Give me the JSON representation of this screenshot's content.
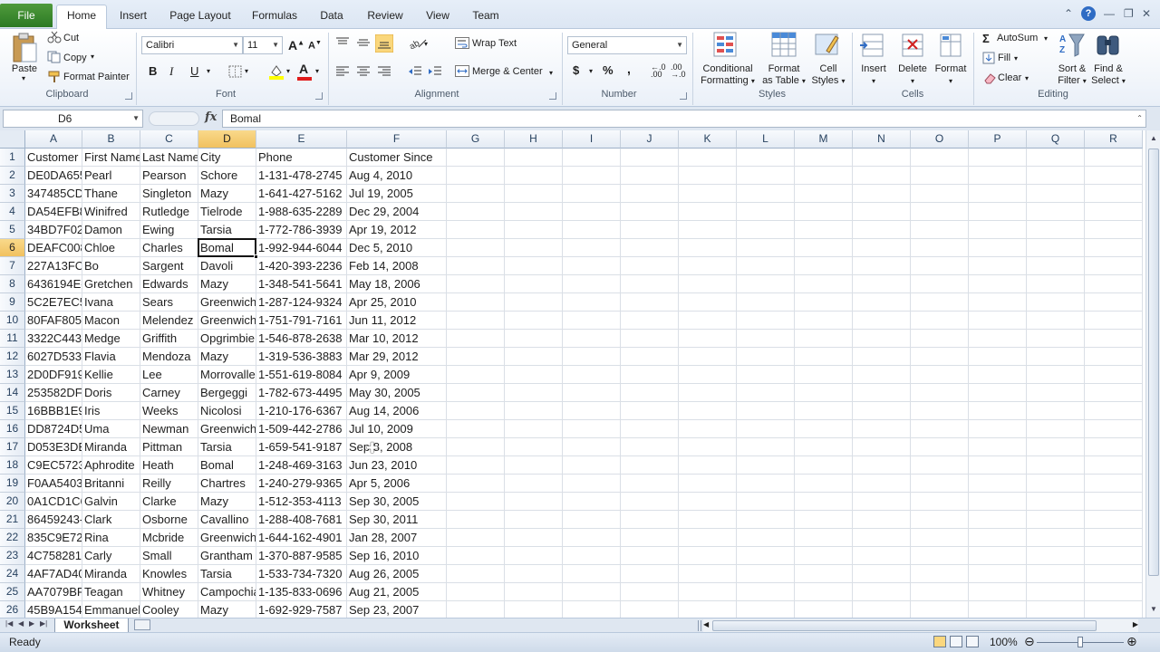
{
  "ribbon_tabs": {
    "file": "File",
    "home": "Home",
    "insert": "Insert",
    "page_layout": "Page Layout",
    "formulas": "Formulas",
    "data": "Data",
    "review": "Review",
    "view": "View",
    "team": "Team"
  },
  "clipboard": {
    "paste": "Paste",
    "cut": "Cut",
    "copy": "Copy",
    "format_painter": "Format Painter",
    "label": "Clipboard"
  },
  "font": {
    "name": "Calibri",
    "size": "11",
    "bold": "B",
    "italic": "I",
    "underline": "U",
    "label": "Font"
  },
  "alignment": {
    "wrap_text": "Wrap Text",
    "merge_center": "Merge & Center",
    "label": "Alignment"
  },
  "number": {
    "format": "General",
    "currency": "$",
    "percent": "%",
    "comma": ",",
    "label": "Number"
  },
  "styles": {
    "conditional": "Conditional",
    "conditional2": "Formatting",
    "format_as": "Format",
    "format_as2": "as Table",
    "cell": "Cell",
    "cell2": "Styles",
    "label": "Styles"
  },
  "cells": {
    "insert": "Insert",
    "delete": "Delete",
    "format": "Format",
    "label": "Cells"
  },
  "editing": {
    "autosum": "AutoSum",
    "fill": "Fill",
    "clear": "Clear",
    "sort": "Sort &",
    "sort2": "Filter",
    "find": "Find &",
    "find2": "Select",
    "label": "Editing",
    "sigma": "Σ"
  },
  "formula_bar": {
    "name_box": "D6",
    "fx": "fx",
    "content": "Bomal"
  },
  "columns": [
    "A",
    "B",
    "C",
    "D",
    "E",
    "F",
    "G",
    "H",
    "I",
    "J",
    "K",
    "L",
    "M",
    "N",
    "O",
    "P",
    "Q",
    "R"
  ],
  "rows": [
    {
      "n": "1",
      "cells": [
        "Customer",
        "First Name",
        "Last Name",
        "City",
        "Phone",
        "Customer Since"
      ]
    },
    {
      "n": "2",
      "cells": [
        "DE0DA655",
        "Pearl",
        "Pearson",
        "Schore",
        "1-131-478-2745",
        "Aug 4, 2010"
      ]
    },
    {
      "n": "3",
      "cells": [
        "347485CD-",
        "Thane",
        "Singleton",
        "Mazy",
        "1-641-427-5162",
        "Jul 19, 2005"
      ]
    },
    {
      "n": "4",
      "cells": [
        "DA54EFB8",
        "Winifred",
        "Rutledge",
        "Tielrode",
        "1-988-635-2289",
        "Dec 29, 2004"
      ]
    },
    {
      "n": "5",
      "cells": [
        "34BD7F02-",
        "Damon",
        "Ewing",
        "Tarsia",
        "1-772-786-3939",
        "Apr 19, 2012"
      ]
    },
    {
      "n": "6",
      "cells": [
        "DEAFC008",
        "Chloe",
        "Charles",
        "Bomal",
        "1-992-944-6044",
        "Dec 5, 2010"
      ]
    },
    {
      "n": "7",
      "cells": [
        "227A13FC-",
        "Bo",
        "Sargent",
        "Davoli",
        "1-420-393-2236",
        "Feb 14, 2008"
      ]
    },
    {
      "n": "8",
      "cells": [
        "6436194E-",
        "Gretchen",
        "Edwards",
        "Mazy",
        "1-348-541-5641",
        "May 18, 2006"
      ]
    },
    {
      "n": "9",
      "cells": [
        "5C2E7EC5-",
        "Ivana",
        "Sears",
        "Greenwich",
        "1-287-124-9324",
        "Apr 25, 2010"
      ]
    },
    {
      "n": "10",
      "cells": [
        "80FAF805-",
        "Macon",
        "Melendez",
        "Greenwich",
        "1-751-791-7161",
        "Jun 11, 2012"
      ]
    },
    {
      "n": "11",
      "cells": [
        "3322C443-",
        "Medge",
        "Griffith",
        "Opgrimbie",
        "1-546-878-2638",
        "Mar 10, 2012"
      ]
    },
    {
      "n": "12",
      "cells": [
        "6027D533-",
        "Flavia",
        "Mendoza",
        "Mazy",
        "1-319-536-3883",
        "Mar 29, 2012"
      ]
    },
    {
      "n": "13",
      "cells": [
        "2D0DF919",
        "Kellie",
        "Lee",
        "Morrovalle",
        "1-551-619-8084",
        "Apr 9, 2009"
      ]
    },
    {
      "n": "14",
      "cells": [
        "253582DF-",
        "Doris",
        "Carney",
        "Bergeggi",
        "1-782-673-4495",
        "May 30, 2005"
      ]
    },
    {
      "n": "15",
      "cells": [
        "16BBB1E9-",
        "Iris",
        "Weeks",
        "Nicolosi",
        "1-210-176-6367",
        "Aug 14, 2006"
      ]
    },
    {
      "n": "16",
      "cells": [
        "DD8724D5",
        "Uma",
        "Newman",
        "Greenwich",
        "1-509-442-2786",
        "Jul 10, 2009"
      ]
    },
    {
      "n": "17",
      "cells": [
        "D053E3DE",
        "Miranda",
        "Pittman",
        "Tarsia",
        "1-659-541-9187",
        "Sep 8, 2008"
      ]
    },
    {
      "n": "18",
      "cells": [
        "C9EC5723-",
        "Aphrodite",
        "Heath",
        "Bomal",
        "1-248-469-3163",
        "Jun 23, 2010"
      ]
    },
    {
      "n": "19",
      "cells": [
        "F0AA5403",
        "Britanni",
        "Reilly",
        "Chartres",
        "1-240-279-9365",
        "Apr 5, 2006"
      ]
    },
    {
      "n": "20",
      "cells": [
        "0A1CD1C6",
        "Galvin",
        "Clarke",
        "Mazy",
        "1-512-353-4113",
        "Sep 30, 2005"
      ]
    },
    {
      "n": "21",
      "cells": [
        "86459243-",
        "Clark",
        "Osborne",
        "Cavallino",
        "1-288-408-7681",
        "Sep 30, 2011"
      ]
    },
    {
      "n": "22",
      "cells": [
        "835C9E72-",
        "Rina",
        "Mcbride",
        "Greenwich",
        "1-644-162-4901",
        "Jan 28, 2007"
      ]
    },
    {
      "n": "23",
      "cells": [
        "4C758281-",
        "Carly",
        "Small",
        "Grantham",
        "1-370-887-9585",
        "Sep 16, 2010"
      ]
    },
    {
      "n": "24",
      "cells": [
        "4AF7AD40",
        "Miranda",
        "Knowles",
        "Tarsia",
        "1-533-734-7320",
        "Aug 26, 2005"
      ]
    },
    {
      "n": "25",
      "cells": [
        "AA7079BF",
        "Teagan",
        "Whitney",
        "Campochiaro",
        "1-135-833-0696",
        "Aug 21, 2005"
      ]
    },
    {
      "n": "26",
      "cells": [
        "45B9A154-",
        "Emmanuel",
        "Cooley",
        "Mazy",
        "1-692-929-7587",
        "Sep 23, 2007"
      ]
    }
  ],
  "selection": {
    "cell": "D6"
  },
  "sheet": {
    "name": "Worksheet"
  },
  "status": {
    "text": "Ready",
    "zoom": "100%"
  },
  "colors": {
    "file_tab": "#2c7a24",
    "selected_header": "#f1c15f",
    "accent": "#27415f"
  }
}
